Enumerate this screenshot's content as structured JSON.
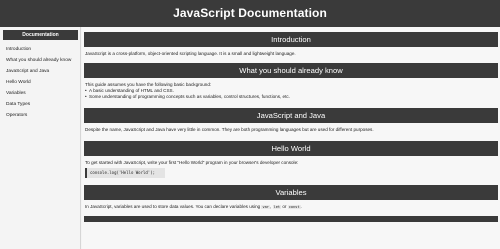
{
  "header": {
    "title": "JavaScript Documentation"
  },
  "sidebar": {
    "title": "Documentation",
    "items": [
      {
        "label": "Introduction"
      },
      {
        "label": "What you should already know"
      },
      {
        "label": "JavaScript and Java"
      },
      {
        "label": "Hello World"
      },
      {
        "label": "Variables"
      },
      {
        "label": "Data Types"
      },
      {
        "label": "Operators"
      }
    ]
  },
  "main": {
    "intro": {
      "heading": "Introduction",
      "text": "JavaScript is a cross-platform, object-oriented scripting language. It is a small and lightweight language."
    },
    "know": {
      "heading": "What you should already know",
      "text": "This guide assumes you have the following basic background:",
      "bullets": [
        "A basic understanding of HTML and CSS.",
        "Some understanding of programming concepts such as variables, control structures, functions, etc."
      ]
    },
    "java": {
      "heading": "JavaScript and Java",
      "text": "Despite the name, JavaScript and Java have very little in common. They are both programming languages but are used for different purposes."
    },
    "hello": {
      "heading": "Hello World",
      "text": "To get started with JavaScript, write your first \"Hello World\" program in your browser's developer console:",
      "code": "console.log('Hello World');"
    },
    "variables": {
      "heading": "Variables",
      "text_before": "In JavaScript, variables are used to store data values. You can declare variables using",
      "kw1": "var",
      "kw2": "let",
      "connector": "or",
      "kw3": "const",
      "text_after": "."
    }
  }
}
